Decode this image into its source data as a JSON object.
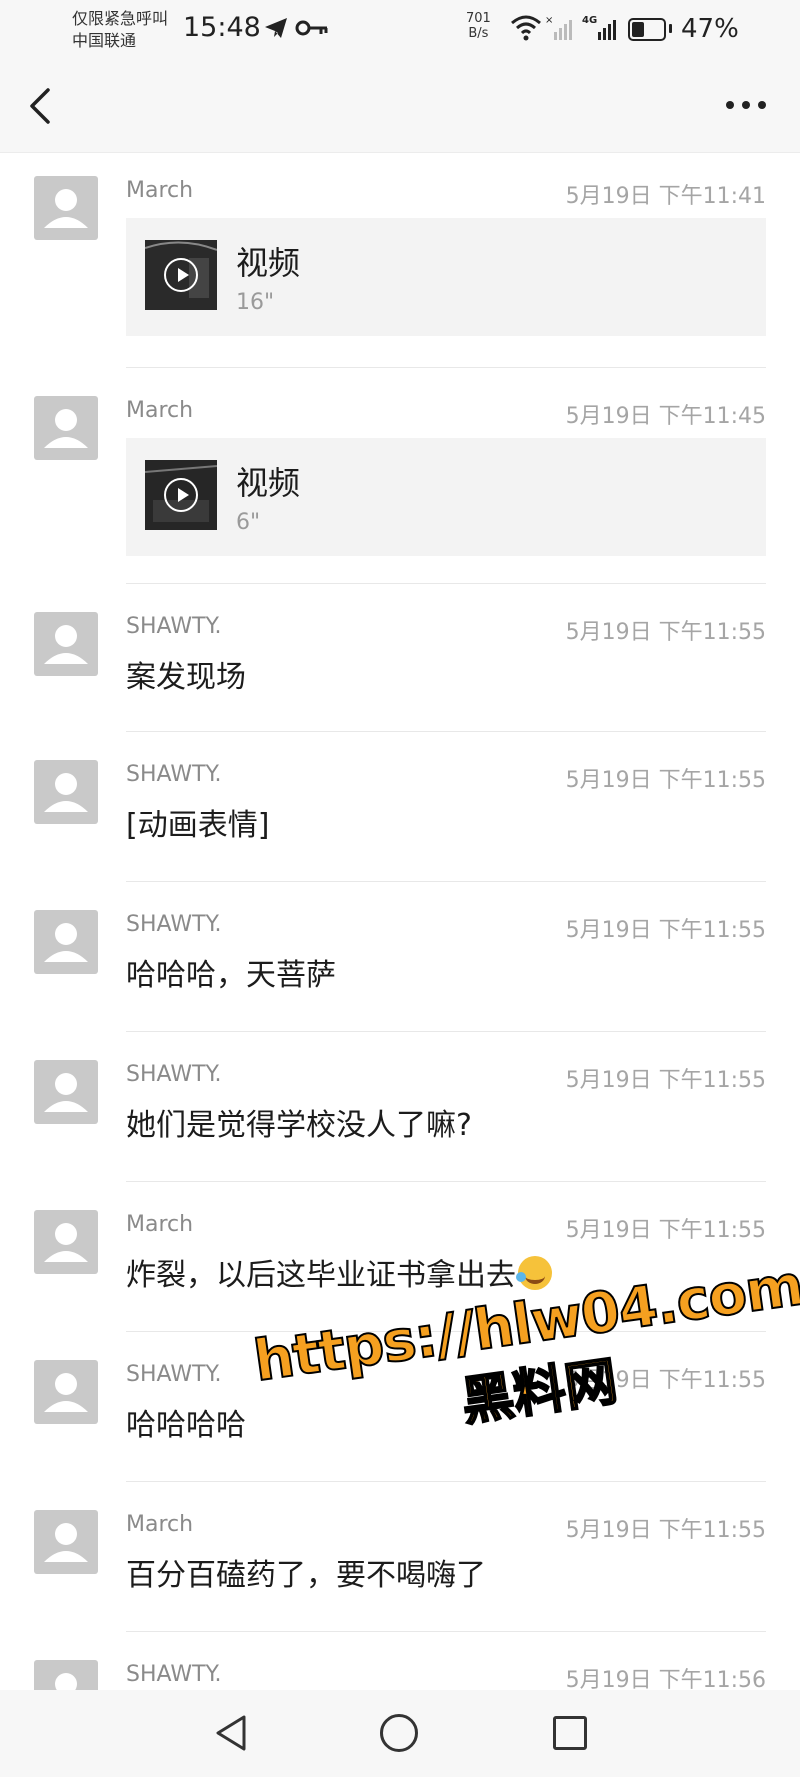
{
  "status_bar": {
    "carrier_line1": "仅限紧急呼叫",
    "carrier_line2": "中国联通",
    "time": "15:48",
    "net_speed_value": "701",
    "net_speed_unit": "B/s",
    "signal_label": "4G",
    "battery_percent": "47%",
    "battery_level": 0.47,
    "icons": [
      "telegram-icon",
      "key-icon",
      "wifi-icon",
      "signal-icon",
      "battery-icon"
    ]
  },
  "header": {
    "back_icon": "back-chevron-icon",
    "more_icon": "more-dots-icon"
  },
  "messages": [
    {
      "sender": "March",
      "time": "5月19日 下午11:41",
      "type": "video",
      "label": "视频",
      "duration": "16\""
    },
    {
      "sender": "March",
      "time": "5月19日 下午11:45",
      "type": "video",
      "label": "视频",
      "duration": "6\""
    },
    {
      "sender": "SHAWTY.",
      "time": "5月19日 下午11:55",
      "type": "text",
      "text": "案发现场"
    },
    {
      "sender": "SHAWTY.",
      "time": "5月19日 下午11:55",
      "type": "text",
      "text": "[动画表情]"
    },
    {
      "sender": "SHAWTY.",
      "time": "5月19日 下午11:55",
      "type": "text",
      "text": "哈哈哈，天菩萨"
    },
    {
      "sender": "SHAWTY.",
      "time": "5月19日 下午11:55",
      "type": "text",
      "text": "她们是觉得学校没人了嘛?"
    },
    {
      "sender": "March",
      "time": "5月19日 下午11:55",
      "type": "text",
      "text": "炸裂，以后这毕业证书拿出去",
      "emoji": "laugh-cry-emoji"
    },
    {
      "sender": "SHAWTY.",
      "time": "5月19日 下午11:55",
      "type": "text",
      "text": "哈哈哈哈"
    },
    {
      "sender": "March",
      "time": "5月19日 下午11:55",
      "type": "text",
      "text": "百分百磕药了，要不喝嗨了"
    },
    {
      "sender": "SHAWTY.",
      "time": "5月19日 下午11:56",
      "type": "text",
      "text": ""
    }
  ],
  "watermark": {
    "url": "https://hlw04.com",
    "name": "黑料网"
  },
  "system_nav": {
    "icons": [
      "nav-back-icon",
      "nav-home-icon",
      "nav-recent-icon"
    ]
  },
  "colors": {
    "watermark_fill": "#f5a020",
    "bar_background": "#f7f7f7",
    "video_card_background": "#f3f3f3"
  }
}
